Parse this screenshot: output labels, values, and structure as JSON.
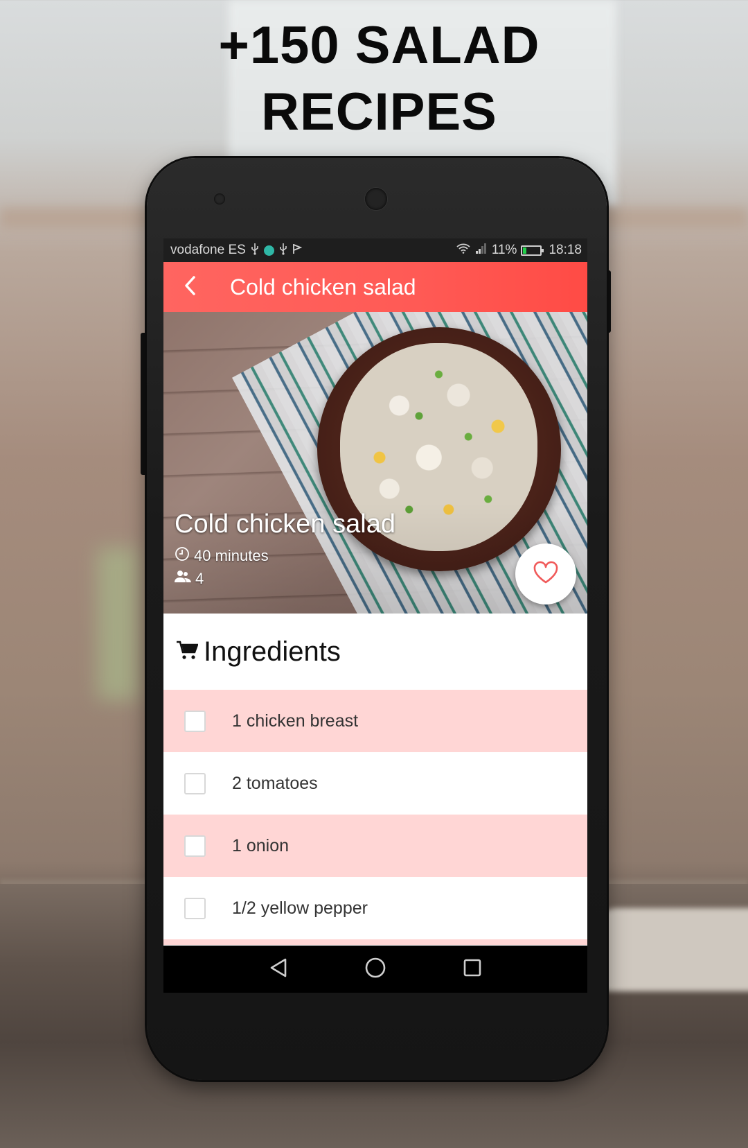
{
  "promo": {
    "headline_line1": "+150 SALAD",
    "headline_line2": "RECIPES"
  },
  "status_bar": {
    "carrier": "vodafone ES",
    "left_icons": [
      "usb-icon",
      "app-notification-dot-icon",
      "usb-icon",
      "notification-flag-icon"
    ],
    "right_icons": [
      "wifi-icon",
      "signal-icon"
    ],
    "battery_percent": "11%",
    "battery_charging": true,
    "time": "18:18"
  },
  "app_bar": {
    "back_icon": "chevron-left-icon",
    "title": "Cold chicken salad",
    "color": "#ff5a55"
  },
  "recipe": {
    "title": "Cold chicken salad",
    "time_icon": "clock-icon",
    "time": "40 minutes",
    "servings_icon": "people-icon",
    "servings": "4",
    "favorite_icon": "heart-outline-icon",
    "favorited": false
  },
  "ingredients": {
    "icon": "shopping-cart-icon",
    "title": "Ingredients",
    "items": [
      {
        "label": "1 chicken breast",
        "checked": false
      },
      {
        "label": "2 tomatoes",
        "checked": false
      },
      {
        "label": "1 onion",
        "checked": false
      },
      {
        "label": "1/2 yellow pepper",
        "checked": false
      }
    ],
    "row_alt_color": "#ffd6d5"
  },
  "nav_bar": {
    "buttons": [
      "back-triangle-icon",
      "home-circle-icon",
      "recents-square-icon"
    ]
  }
}
